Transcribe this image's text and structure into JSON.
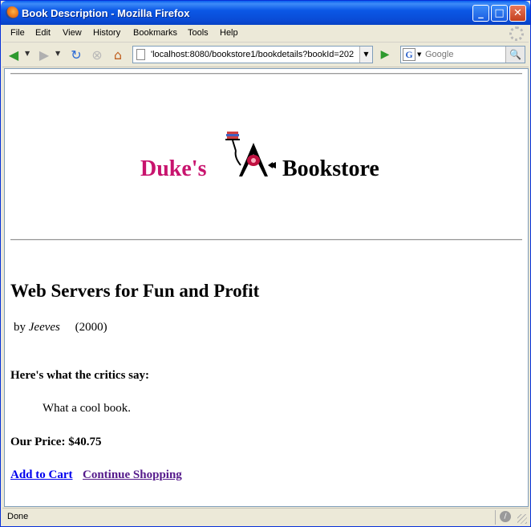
{
  "window": {
    "title": "Book Description - Mozilla Firefox",
    "controls": {
      "minimize": "_",
      "maximize": "□",
      "close": "✕"
    }
  },
  "menu": {
    "items": [
      "File",
      "Edit",
      "View",
      "History",
      "Bookmarks",
      "Tools",
      "Help"
    ]
  },
  "toolbar": {
    "back_icon": "back-arrow-icon",
    "forward_icon": "forward-arrow-icon",
    "reload_icon": "reload-icon",
    "stop_icon": "stop-icon",
    "home_icon": "home-icon",
    "url": "'localhost:8080/bookstore1/bookdetails?bookId=202",
    "search_engine": "G",
    "search_placeholder": "Google"
  },
  "page": {
    "banner": {
      "dukes": "Duke's",
      "bookstore": "Bookstore"
    },
    "book": {
      "title": "Web Servers for Fun and Profit",
      "by": "by",
      "author": "Jeeves",
      "year": "(2000)"
    },
    "critics_heading": "Here's what the critics say:",
    "critics_quote": "What a cool book.",
    "price": "Our Price: $40.75",
    "links": {
      "add_to_cart": "Add to Cart",
      "continue_shopping": "Continue Shopping"
    }
  },
  "status": {
    "text": "Done"
  },
  "colors": {
    "brand_magenta": "#C8146E",
    "link_unvisited": "#0000EE",
    "link_visited": "#551A8B"
  }
}
